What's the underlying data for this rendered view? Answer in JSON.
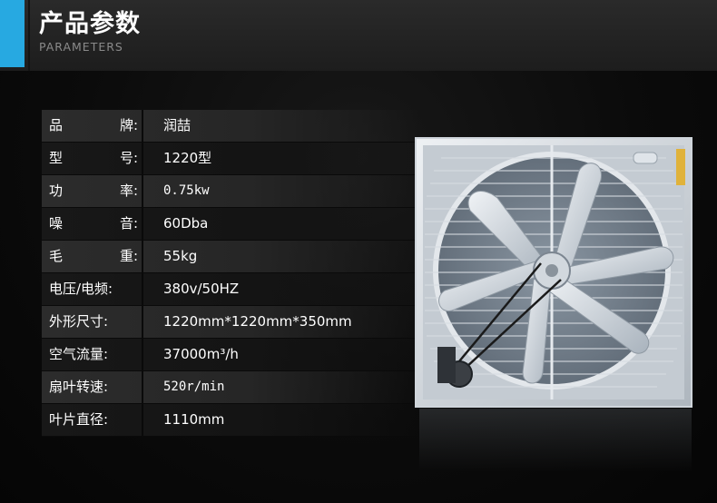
{
  "header": {
    "title": "产品参数",
    "subtitle": "PARAMETERS"
  },
  "specs": [
    {
      "label": "品牌:",
      "value": "润喆"
    },
    {
      "label": "型号:",
      "value": "1220型"
    },
    {
      "label": "功率:",
      "value": "0.75kw"
    },
    {
      "label": "噪音:",
      "value": "60Dba"
    },
    {
      "label": "毛重:",
      "value": "55kg"
    },
    {
      "label": "电压/电频:",
      "value": "380v/50HZ"
    },
    {
      "label": "外形尺寸:",
      "value": "1220mm*1220mm*350mm"
    },
    {
      "label": "空气流量:",
      "value": "37000m³/h"
    },
    {
      "label": "扇叶转速:",
      "value": "520r/min"
    },
    {
      "label": "叶片直径:",
      "value": "1110mm"
    }
  ],
  "colors": {
    "accent": "#27a9e1",
    "header_bg": "#222222",
    "page_bg": "#0a0a0a"
  },
  "image": {
    "subject": "exhaust-fan-product-photo"
  }
}
